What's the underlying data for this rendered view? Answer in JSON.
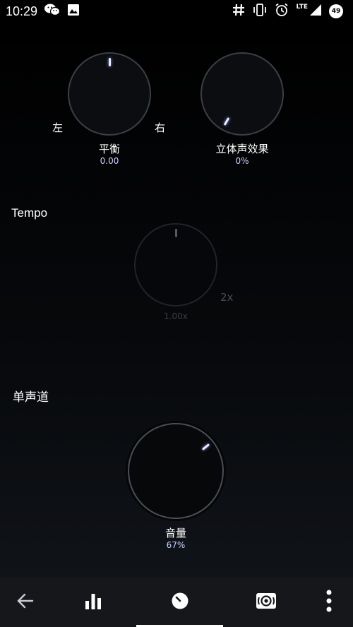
{
  "status_bar": {
    "time": "10:29",
    "left_icons": [
      "wechat-icon",
      "image-icon"
    ],
    "right_icons": [
      "hashtag-icon",
      "vibrate-icon",
      "alarm-icon",
      "signal-icon"
    ],
    "network": "LTE",
    "battery": "49"
  },
  "balance": {
    "name": "平衡",
    "value": "0.00",
    "left_label": "左",
    "right_label": "右",
    "level": 0.5
  },
  "stereo": {
    "name": "立体声效果",
    "value": "0%",
    "level": 0
  },
  "tempo": {
    "section_title": "Tempo",
    "value": "1.00x",
    "max_label": "2x",
    "level": 0.5
  },
  "mono": {
    "section_title": "单声道"
  },
  "volume": {
    "name": "音量",
    "value": "67%",
    "level": 0.67
  },
  "nav": {
    "items": [
      "back-arrow-icon",
      "equalizer-bars-icon",
      "knob-dial-icon",
      "surround-speaker-icon",
      "more-vert-icon"
    ],
    "active": "knob-dial-icon"
  },
  "colors": {
    "background": "#000000",
    "indicator": "#e8ecff",
    "value_text": "#c9d3ff",
    "navbar": "#15171b"
  }
}
